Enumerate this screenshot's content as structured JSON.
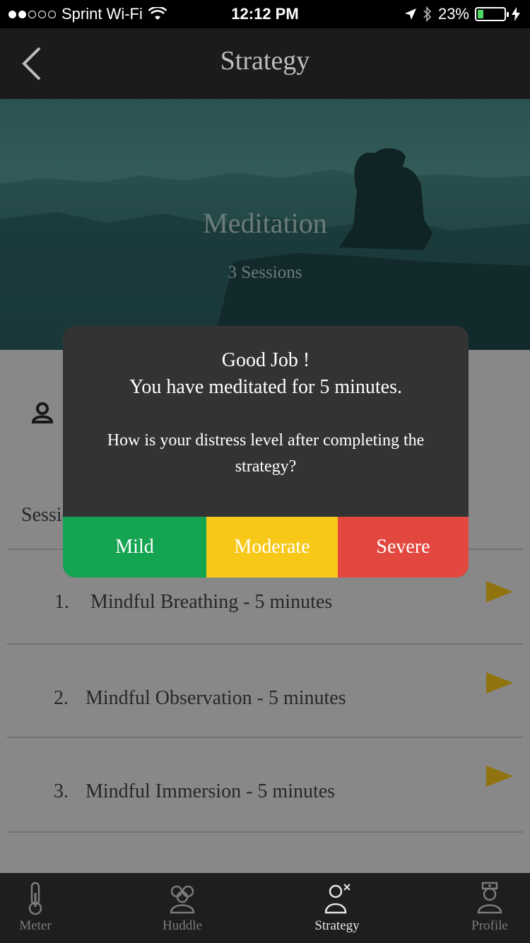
{
  "status_bar": {
    "carrier": "Sprint Wi-Fi",
    "time": "12:12 PM",
    "battery": "23%",
    "battery_level": 0.23
  },
  "nav": {
    "title": "Strategy",
    "back_icon": "chevron-left-icon"
  },
  "hero": {
    "title": "Meditation",
    "subtitle": "3 Sessions"
  },
  "content": {
    "sessions_label": "Sessions",
    "sessions": [
      {
        "number": "1.",
        "title": "Mindful Breathing - 5 minutes"
      },
      {
        "number": "2.",
        "title": "Mindful Observation - 5 minutes"
      },
      {
        "number": "3.",
        "title": "Mindful Immersion - 5 minutes"
      }
    ],
    "play_color": "#d4a915"
  },
  "modal": {
    "title": "Good Job !",
    "message": "You have meditated for 5 minutes.",
    "question": "How is your distress level after completing the strategy?",
    "choices": {
      "mild": "Mild",
      "moderate": "Moderate",
      "severe": "Severe"
    },
    "colors": {
      "mild": "#15a552",
      "moderate": "#f7c818",
      "severe": "#e34840"
    }
  },
  "tab_bar": {
    "tabs": [
      {
        "label": "Meter",
        "icon": "thermometer-icon"
      },
      {
        "label": "Huddle",
        "icon": "group-icon"
      },
      {
        "label": "Strategy",
        "icon": "strategy-icon"
      },
      {
        "label": "Profile",
        "icon": "nurse-icon"
      }
    ],
    "active": "Strategy"
  }
}
